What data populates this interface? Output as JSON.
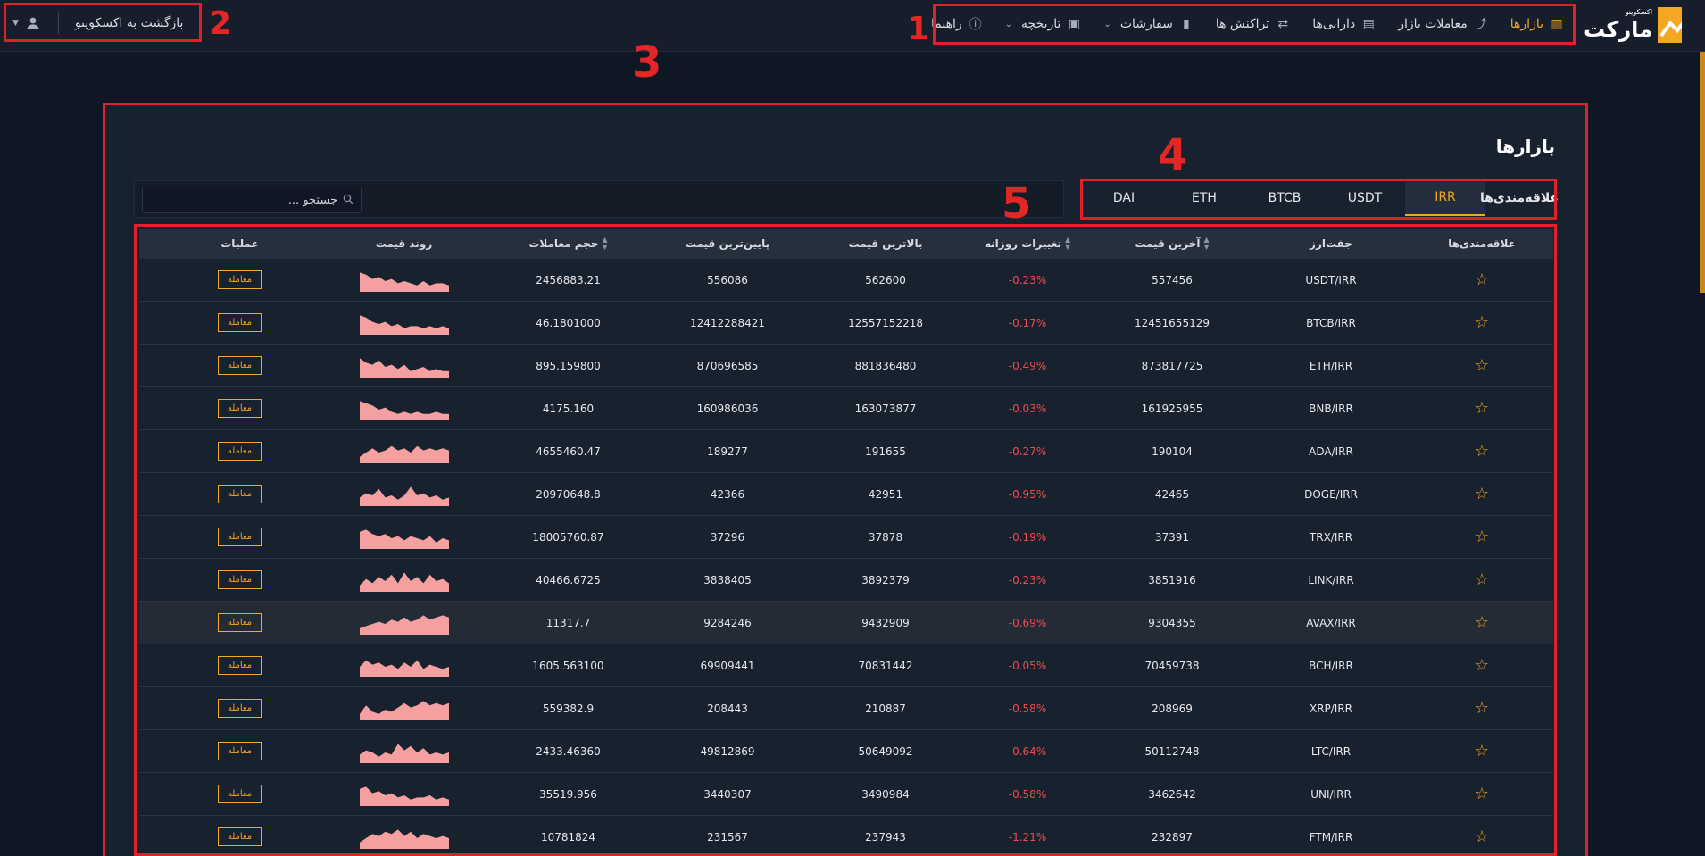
{
  "logo": {
    "small": "اکسکوینو",
    "big": "مارکت"
  },
  "nav": [
    {
      "label": "بازارها",
      "icon": "bar-chart-icon",
      "active": true
    },
    {
      "label": "معاملات بازار",
      "icon": "trend-icon"
    },
    {
      "label": "دارایی‌ها",
      "icon": "cash-icon"
    },
    {
      "label": "تراکنش ها",
      "icon": "exchange-icon"
    },
    {
      "label": "سفارشات",
      "icon": "book-icon",
      "dropdown": true
    },
    {
      "label": "تاریخچه",
      "icon": "archive-icon",
      "dropdown": true
    },
    {
      "label": "راهنما",
      "icon": "info-icon"
    }
  ],
  "header": {
    "back_label": "بازگشت به اکسکوینو"
  },
  "markers": [
    "1",
    "2",
    "3",
    "4",
    "5"
  ],
  "page_title": "بازارها",
  "tabs": [
    "علاقه‌مندی‌ها",
    "IRR",
    "USDT",
    "BTCB",
    "ETH",
    "DAI"
  ],
  "search": {
    "placeholder": "جستجو ..."
  },
  "columns": [
    "علاقه‌مندی‌ها",
    "جفت‌ارز",
    "آخرین قیمت",
    "تغییرات روزانه",
    "بالاترین قیمت",
    "پایین‌ترین قیمت",
    "حجم معاملات",
    "روند قیمت",
    "عملیات"
  ],
  "trade_label": "معامله",
  "rows": [
    {
      "pair": "USDT/IRR",
      "last": "557456",
      "change": "-0.23%",
      "high": "562600",
      "low": "556086",
      "volume": "2456883.21",
      "trend": [
        9,
        8,
        6,
        7,
        5,
        6,
        4,
        5,
        4,
        3,
        5,
        3,
        4,
        4,
        3
      ]
    },
    {
      "pair": "BTCB/IRR",
      "last": "12451655129",
      "change": "-0.17%",
      "high": "12557152218",
      "low": "12412288421",
      "volume": "46.1801000",
      "trend": [
        9,
        8,
        6,
        5,
        6,
        4,
        5,
        3,
        4,
        4,
        3,
        4,
        3,
        4,
        3
      ]
    },
    {
      "pair": "ETH/IRR",
      "last": "873817725",
      "change": "-0.49%",
      "high": "881836480",
      "low": "870696585",
      "volume": "895.159800",
      "trend": [
        9,
        7,
        6,
        8,
        5,
        6,
        4,
        6,
        3,
        4,
        5,
        3,
        4,
        3,
        3
      ]
    },
    {
      "pair": "BNB/IRR",
      "last": "161925955",
      "change": "-0.03%",
      "high": "163073877",
      "low": "160986036",
      "volume": "4175.160",
      "trend": [
        9,
        8,
        7,
        5,
        6,
        4,
        3,
        4,
        3,
        4,
        3,
        3,
        4,
        3,
        3
      ]
    },
    {
      "pair": "ADA/IRR",
      "last": "190104",
      "change": "-0.27%",
      "high": "191655",
      "low": "189277",
      "volume": "4655460.47",
      "trend": [
        3,
        5,
        7,
        5,
        6,
        8,
        6,
        7,
        5,
        8,
        6,
        7,
        6,
        7,
        6
      ]
    },
    {
      "pair": "DOGE/IRR",
      "last": "42465",
      "change": "-0.95%",
      "high": "42951",
      "low": "42366",
      "volume": "20970648.8",
      "trend": [
        4,
        6,
        5,
        8,
        4,
        5,
        3,
        5,
        9,
        5,
        6,
        4,
        5,
        3,
        4
      ]
    },
    {
      "pair": "TRX/IRR",
      "last": "37391",
      "change": "-0.19%",
      "high": "37878",
      "low": "37296",
      "volume": "18005760.87",
      "trend": [
        8,
        9,
        7,
        6,
        7,
        5,
        6,
        4,
        6,
        5,
        4,
        6,
        3,
        5,
        4
      ]
    },
    {
      "pair": "LINK/IRR",
      "last": "3851916",
      "change": "-0.23%",
      "high": "3892379",
      "low": "3838405",
      "volume": "40466.6725",
      "trend": [
        3,
        6,
        4,
        7,
        5,
        8,
        4,
        9,
        5,
        7,
        4,
        8,
        5,
        6,
        4
      ]
    },
    {
      "pair": "AVAX/IRR",
      "last": "9304355",
      "change": "-0.69%",
      "high": "9432909",
      "low": "9284246",
      "volume": "11317.7",
      "trend": [
        3,
        4,
        5,
        6,
        5,
        7,
        6,
        8,
        6,
        7,
        9,
        7,
        8,
        9,
        8
      ]
    },
    {
      "pair": "BCH/IRR",
      "last": "70459738",
      "change": "-0.05%",
      "high": "70831442",
      "low": "69909441",
      "volume": "1605.563100",
      "trend": [
        5,
        8,
        6,
        7,
        5,
        6,
        4,
        7,
        5,
        8,
        4,
        6,
        5,
        4,
        5
      ]
    },
    {
      "pair": "XRP/IRR",
      "last": "208969",
      "change": "-0.58%",
      "high": "210887",
      "low": "208443",
      "volume": "559382.9",
      "trend": [
        3,
        7,
        4,
        3,
        5,
        4,
        6,
        8,
        6,
        7,
        9,
        7,
        8,
        7,
        8
      ]
    },
    {
      "pair": "LTC/IRR",
      "last": "50112748",
      "change": "-0.64%",
      "high": "50649092",
      "low": "49812869",
      "volume": "2433.46360",
      "trend": [
        4,
        6,
        5,
        3,
        5,
        4,
        9,
        6,
        8,
        5,
        7,
        4,
        5,
        4,
        5
      ]
    },
    {
      "pair": "UNI/IRR",
      "last": "3462642",
      "change": "-0.58%",
      "high": "3490984",
      "low": "3440307",
      "volume": "35519.956",
      "trend": [
        8,
        9,
        6,
        7,
        5,
        6,
        4,
        5,
        3,
        4,
        4,
        5,
        3,
        4,
        3
      ]
    },
    {
      "pair": "FTM/IRR",
      "last": "232897",
      "change": "-1.21%",
      "high": "237943",
      "low": "231567",
      "volume": "10781824",
      "trend": [
        3,
        5,
        7,
        6,
        8,
        7,
        9,
        6,
        8,
        5,
        7,
        6,
        5,
        6,
        5
      ]
    }
  ],
  "colors": {
    "accent": "#f5a623",
    "negative": "#f0494f",
    "marker": "#e0202a",
    "spark": "#f4a0a0"
  }
}
